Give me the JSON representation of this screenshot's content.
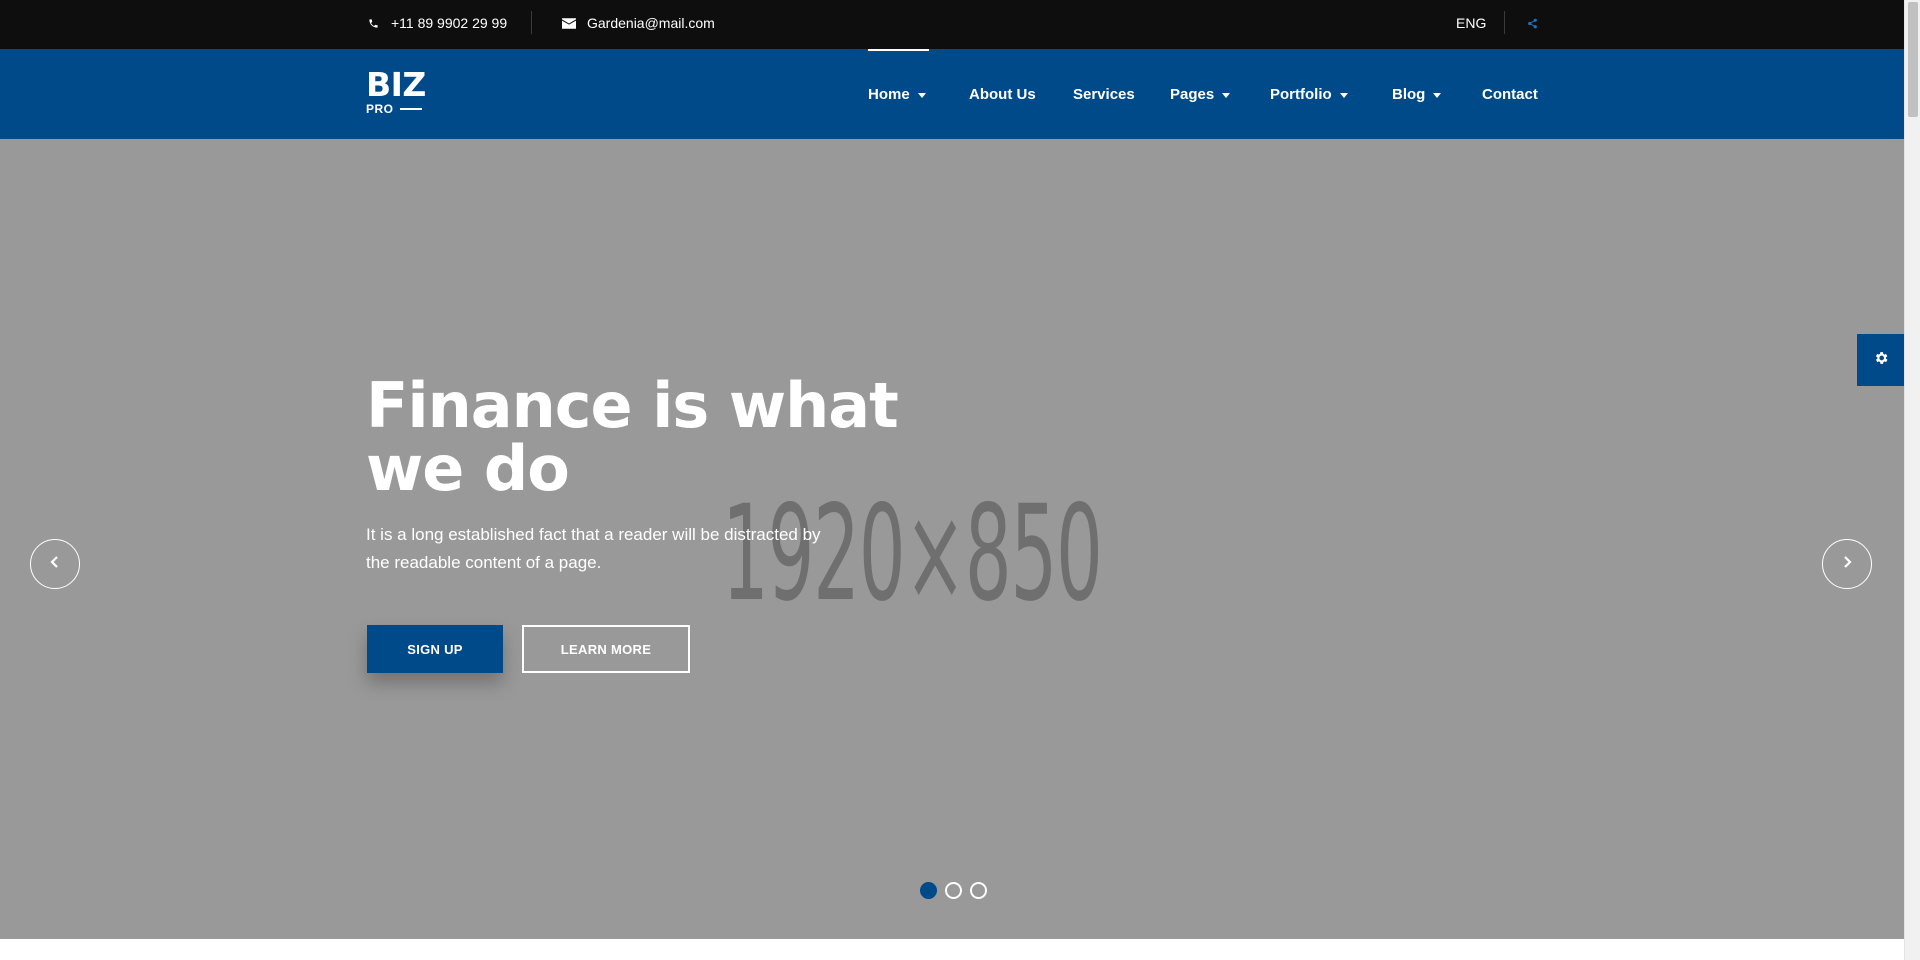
{
  "topbar": {
    "phone": "+11 89 9902 29 99",
    "email": "Gardenia@mail.com",
    "language": "ENG"
  },
  "logo": {
    "main": "BIZ",
    "sub": "PRO"
  },
  "nav": {
    "home": "Home",
    "about": "About Us",
    "services": "Services",
    "pages": "Pages",
    "portfolio": "Portfolio",
    "blog": "Blog",
    "contact": "Contact"
  },
  "hero": {
    "placeholder": "1920×850",
    "headline_line1": "Finance is what",
    "headline_line2": "we do",
    "subtext": "It is a long established fact that a reader will be distracted by the readable content of a page.",
    "signup_label": "SIGN UP",
    "learnmore_label": "LEARN MORE",
    "slides_total": 3,
    "active_slide": 1
  },
  "colors": {
    "brand": "#004a89",
    "topbar": "#0e0e0e",
    "hero_bg": "#999999"
  },
  "icons": {
    "phone": "phone-icon",
    "email": "envelope-icon",
    "share": "share-icon",
    "settings": "gear-icon",
    "prev": "chevron-left-icon",
    "next": "chevron-right-icon"
  }
}
